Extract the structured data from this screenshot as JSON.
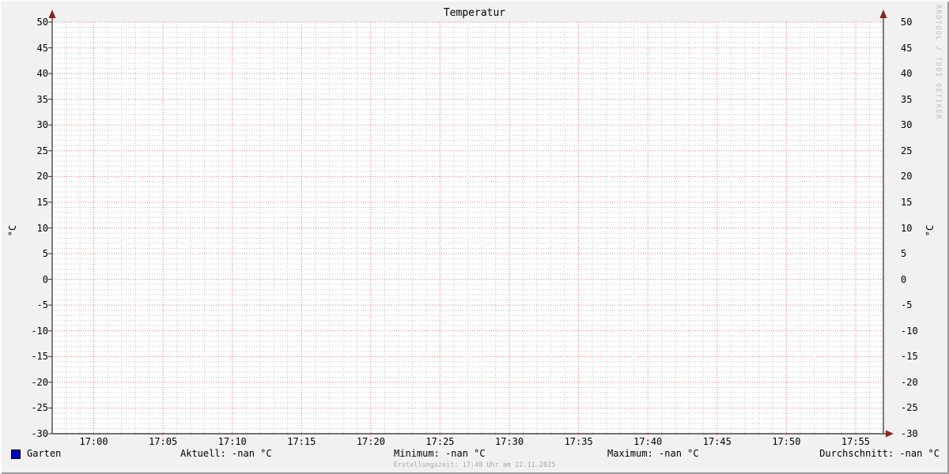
{
  "title": "Temperatur",
  "watermark": "RRDTOOL / TOBI OETIKER",
  "y_axis_unit": "°C",
  "chart_data": {
    "type": "line",
    "title": "Temperatur",
    "ylabel": "°C",
    "ylim": [
      -30,
      50
    ],
    "y_tick_step_major": 5,
    "y_tick_step_minor": 1,
    "y_ticks": [
      50,
      45,
      40,
      35,
      30,
      25,
      20,
      15,
      10,
      5,
      0,
      -5,
      -10,
      -15,
      -20,
      -25,
      -30
    ],
    "x_ticks": [
      "17:00",
      "17:05",
      "17:10",
      "17:15",
      "17:20",
      "17:25",
      "17:30",
      "17:35",
      "17:40",
      "17:45",
      "17:50",
      "17:55"
    ],
    "x_minutes_total": 60,
    "x_minutes_before_first_major": 3,
    "x_minor_per_major": 5,
    "grid": true,
    "legend_position": "bottom",
    "series": [
      {
        "name": "Garten",
        "color": "#0000c8",
        "values": []
      }
    ]
  },
  "legend": {
    "series": [
      {
        "label": "Garten",
        "color": "#0000c8"
      }
    ],
    "stats": [
      {
        "label": "Aktuell:",
        "value": "-nan °C"
      },
      {
        "label": "Minimum:",
        "value": "-nan °C"
      },
      {
        "label": "Maximum:",
        "value": "-nan °C"
      },
      {
        "label": "Durchschnitt:",
        "value": "-nan °C"
      }
    ]
  },
  "footer": {
    "creation_time": "Erstellungszeit: 17:48 Uhr am 22.11.2025"
  },
  "colors": {
    "background": "#f1f1f1",
    "canvas": "#ffffff",
    "major_grid": "#e97777",
    "minor_grid": "#c6c6c6",
    "axis": "#474747",
    "arrow": "#8b2323",
    "series_garten": "#0000c8",
    "muted_text": "#a9a9a9",
    "watermark_text": "#bdbdbd"
  }
}
